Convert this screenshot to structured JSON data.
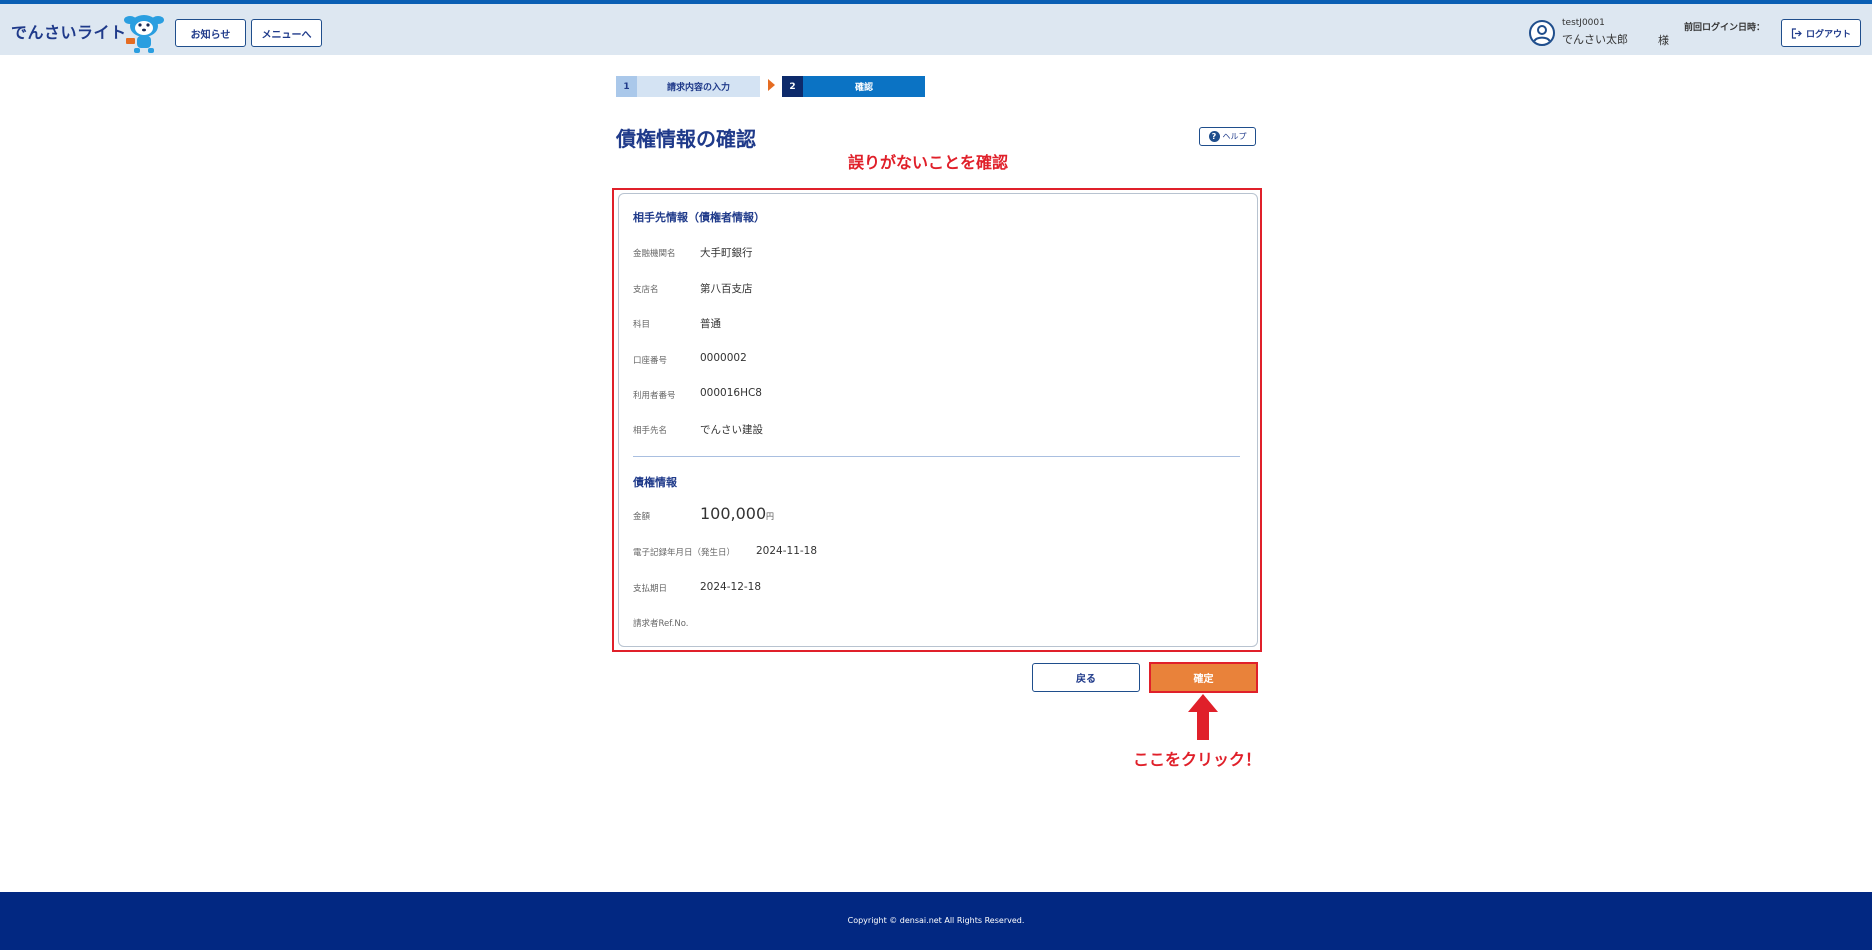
{
  "header": {
    "app_name": "でんさいライト",
    "news_label": "お知らせ",
    "menu_label": "メニューへ",
    "user_id": "testJ0001",
    "user_name": "でんさい太郎",
    "user_honorific": "様",
    "last_login_label": "前回ログイン日時：",
    "logout_label": "ログアウト"
  },
  "steps": [
    {
      "number": "1",
      "label": "請求内容の入力",
      "state": "done"
    },
    {
      "number": "2",
      "label": "確認",
      "state": "current"
    }
  ],
  "page": {
    "title": "債権情報の確認",
    "help_label": "ヘルプ"
  },
  "annotations": {
    "top": "誤りがないことを確認",
    "bottom": "ここをクリック！",
    "color": "#e0202a"
  },
  "counterparty": {
    "section_title": "相手先情報（債権者情報）",
    "fields": [
      {
        "label": "金融機関名",
        "value": "大手町銀行"
      },
      {
        "label": "支店名",
        "value": "第八百支店"
      },
      {
        "label": "科目",
        "value": "普通"
      },
      {
        "label": "口座番号",
        "value": "0000002"
      },
      {
        "label": "利用者番号",
        "value": "000016HC8"
      },
      {
        "label": "相手先名",
        "value": "でんさい建設"
      }
    ]
  },
  "claim": {
    "section_title": "債権情報",
    "amount_label": "金額",
    "amount_value": "100,000",
    "amount_unit": "円",
    "record_date_label": "電子記録年月日（発生日）",
    "record_date_value": "2024-11-18",
    "due_date_label": "支払期日",
    "due_date_value": "2024-12-18",
    "ref_label": "請求者Ref.No.",
    "ref_value": ""
  },
  "actions": {
    "back_label": "戻る",
    "confirm_label": "確定"
  },
  "footer": {
    "copyright": "Copyright © densai.net All Rights Reserved."
  },
  "colors": {
    "brand_navy": "#022882",
    "accent_orange": "#e9823a",
    "step_active": "#0b73c4",
    "header_bg": "#dde7f1"
  }
}
